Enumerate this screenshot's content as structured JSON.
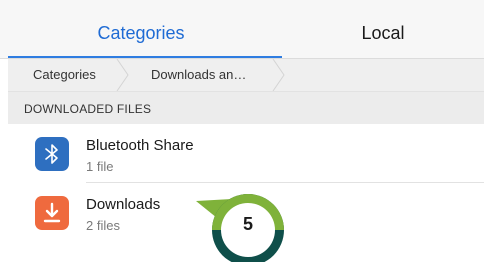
{
  "tabs": {
    "categories": "Categories",
    "local": "Local"
  },
  "breadcrumb": [
    "Categories",
    "Downloads an…"
  ],
  "section": {
    "title": "DOWNLOADED FILES"
  },
  "items": [
    {
      "title": "Bluetooth Share",
      "subtitle": "1 file",
      "icon": "bluetooth-icon"
    },
    {
      "title": "Downloads",
      "subtitle": "2 files",
      "icon": "download-icon"
    }
  ],
  "step_marker": {
    "number": "5"
  },
  "colors": {
    "accent": "#2f7de1",
    "marker_green": "#7fb23a",
    "marker_dark": "#0f4f4a"
  }
}
